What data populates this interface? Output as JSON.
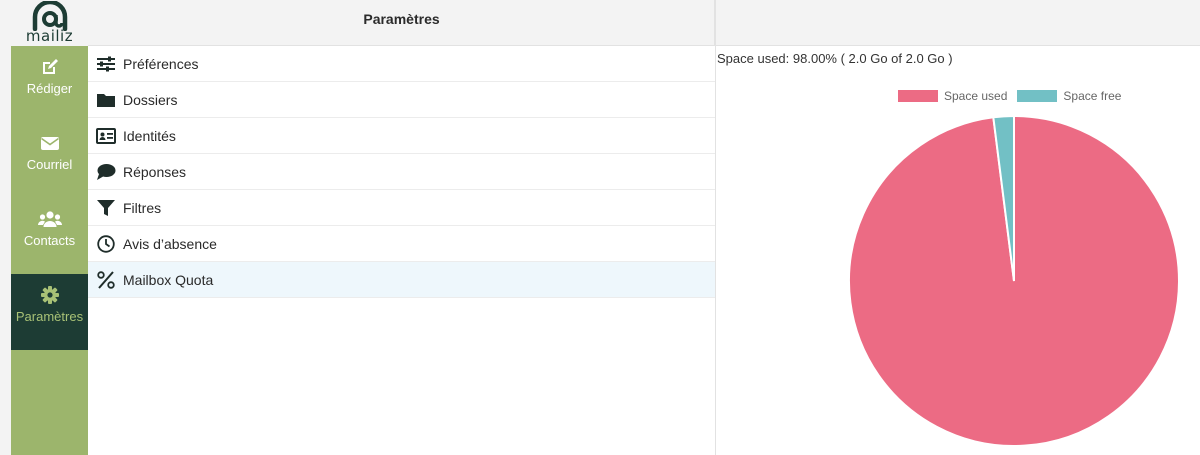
{
  "app": {
    "logo_text": "mailiz"
  },
  "header": {
    "title": "Paramètres"
  },
  "nav": {
    "items": [
      {
        "label": "Rédiger",
        "icon": "compose-icon",
        "active": false
      },
      {
        "label": "Courriel",
        "icon": "envelope-icon",
        "active": false
      },
      {
        "label": "Contacts",
        "icon": "users-icon",
        "active": false
      },
      {
        "label": "Paramètres",
        "icon": "gear-icon",
        "active": true
      }
    ]
  },
  "settings": {
    "items": [
      {
        "label": "Préférences",
        "icon": "sliders-icon"
      },
      {
        "label": "Dossiers",
        "icon": "folder-icon"
      },
      {
        "label": "Identités",
        "icon": "id-card-icon"
      },
      {
        "label": "Réponses",
        "icon": "comment-icon"
      },
      {
        "label": "Filtres",
        "icon": "filter-icon"
      },
      {
        "label": "Avis d’absence",
        "icon": "clock-icon"
      },
      {
        "label": "Mailbox Quota",
        "icon": "percent-icon",
        "selected": true
      }
    ]
  },
  "quota": {
    "summary": "Space used: 98.00% ( 2.0 Go of 2.0 Go )"
  },
  "colors": {
    "nav_bg": "#9cb56c",
    "nav_active_bg": "#1d3c34",
    "used": "#ec6b84",
    "free": "#72c0c5"
  },
  "chart_data": {
    "type": "pie",
    "labels": [
      "Space used",
      "Space free"
    ],
    "values": [
      98,
      2
    ],
    "colors": [
      "#ec6b84",
      "#72c0c5"
    ],
    "legend": "top"
  }
}
